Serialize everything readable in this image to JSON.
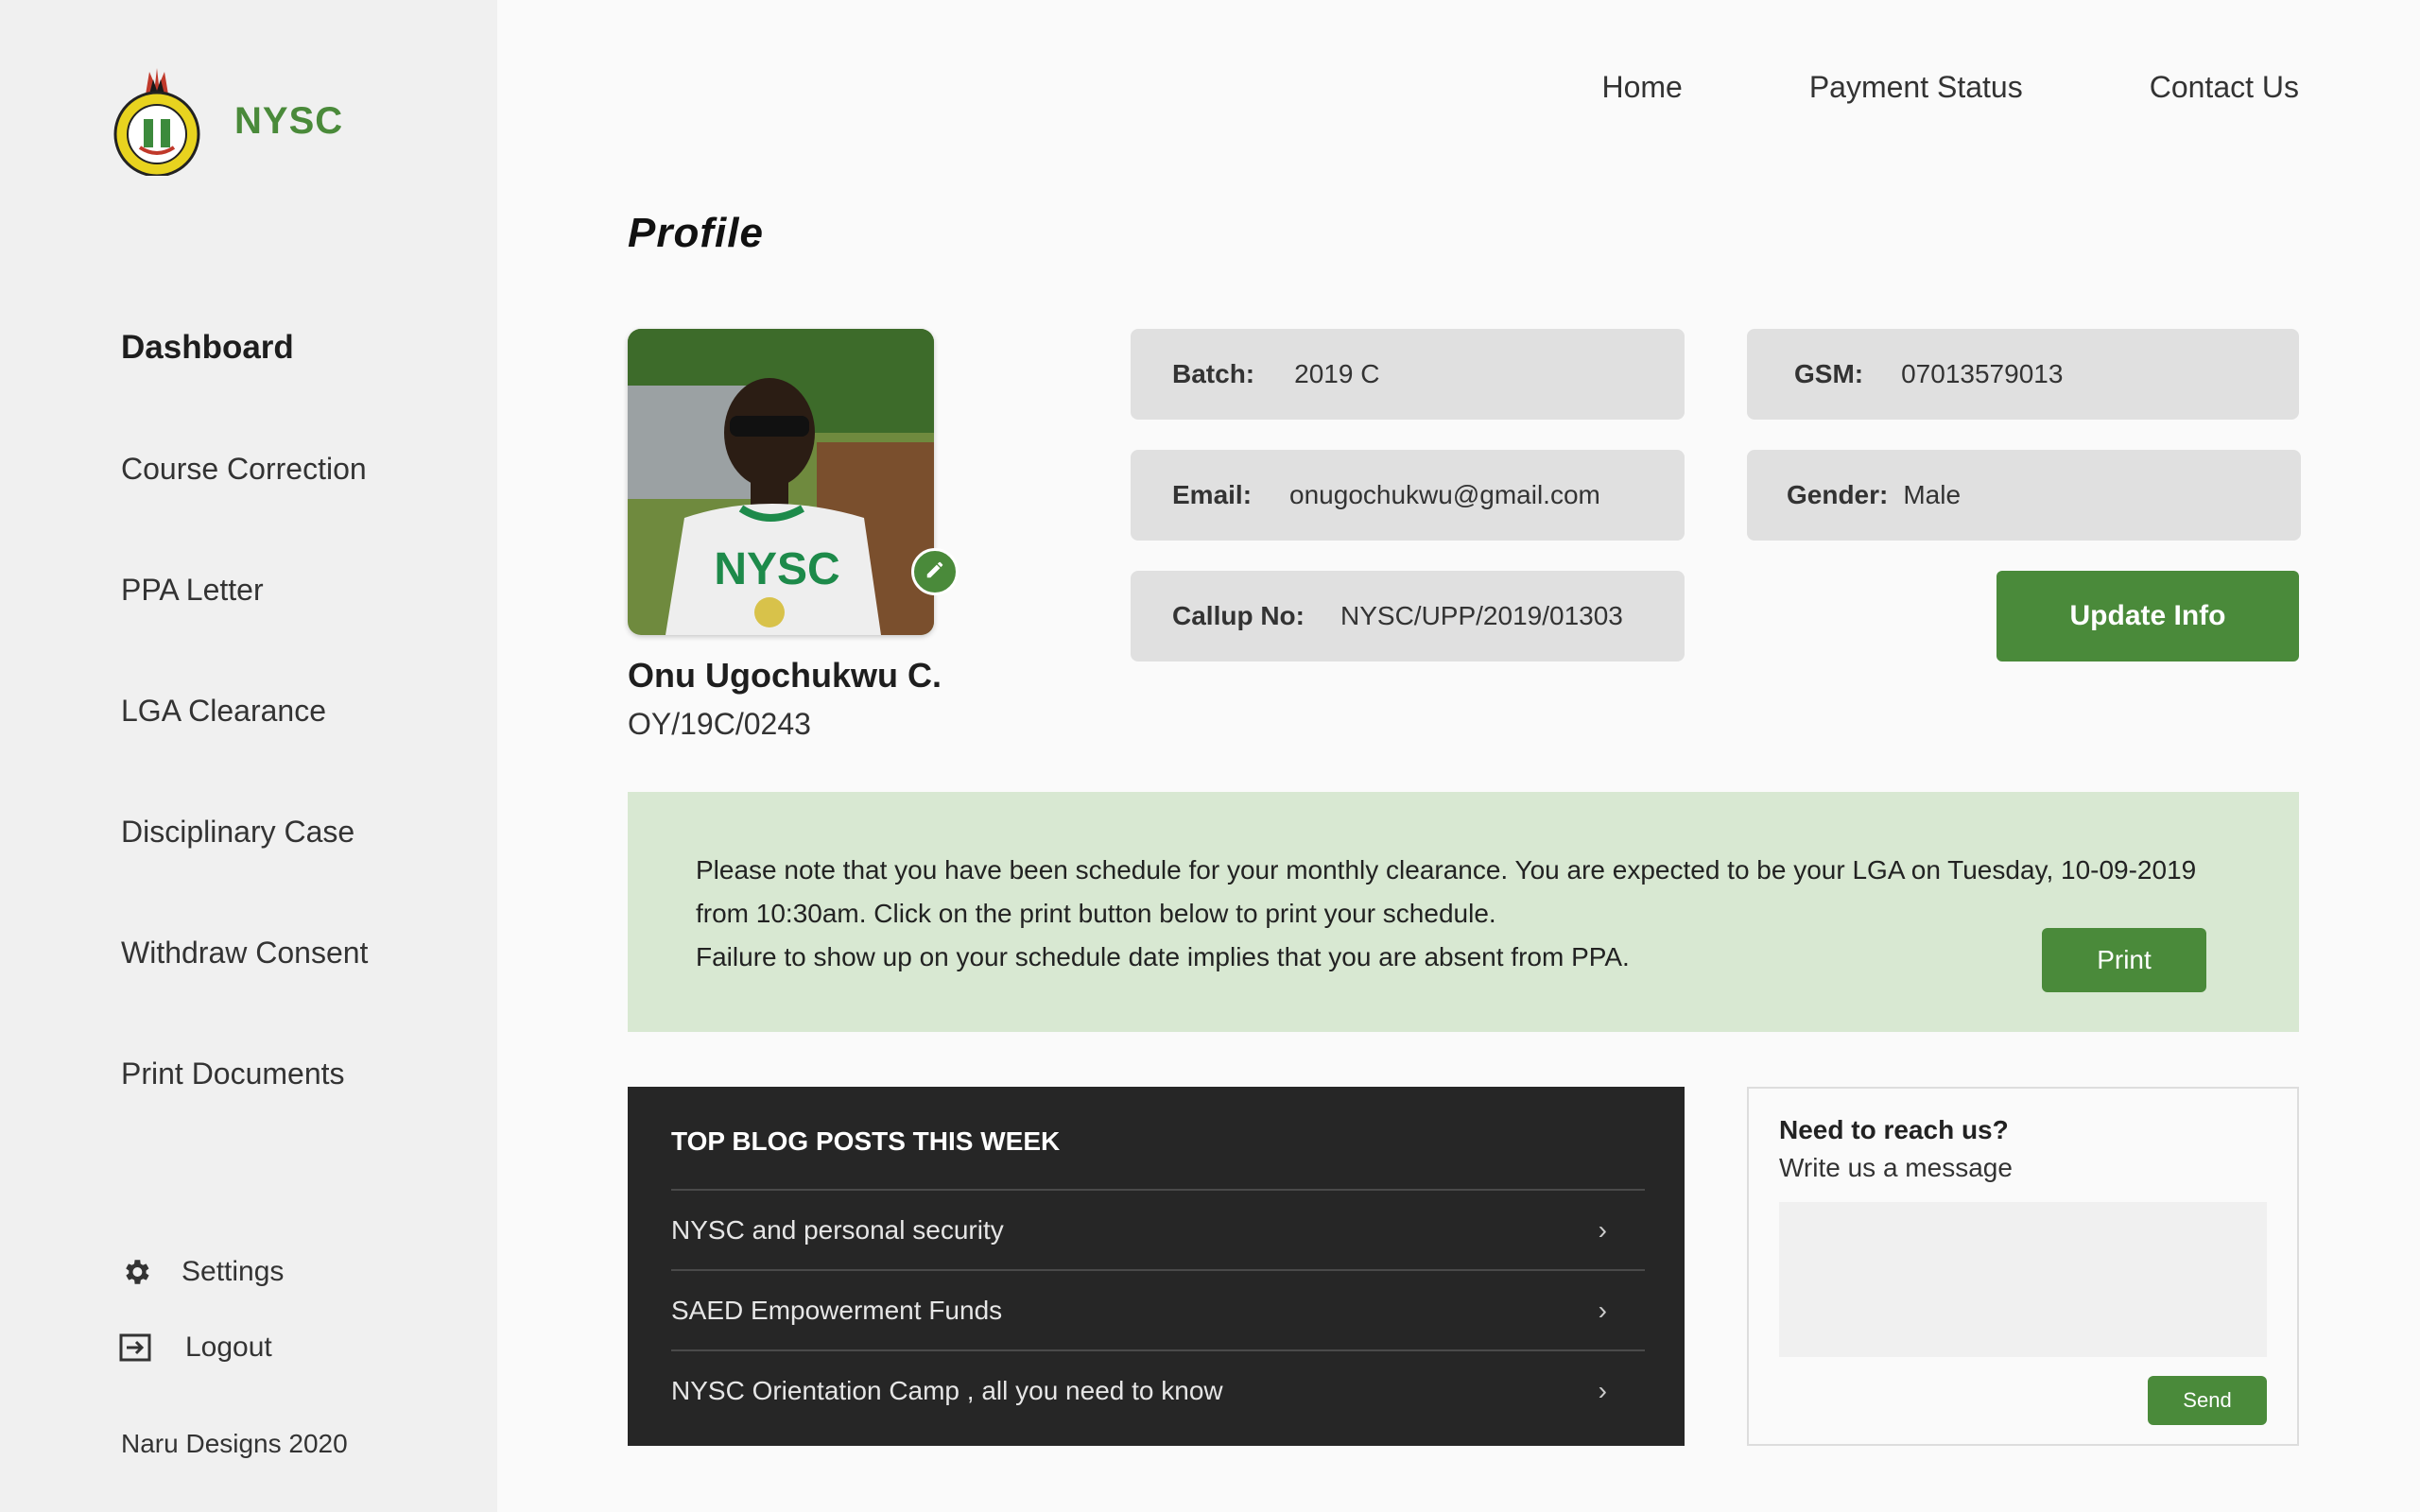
{
  "brand": {
    "name": "NYSC",
    "accent": "#4a8a3a"
  },
  "sidebar": {
    "items": [
      {
        "label": "Dashboard",
        "active": true
      },
      {
        "label": "Course Correction"
      },
      {
        "label": "PPA Letter"
      },
      {
        "label": "LGA Clearance"
      },
      {
        "label": "Disciplinary Case"
      },
      {
        "label": "Withdraw Consent"
      },
      {
        "label": "Print Documents"
      }
    ],
    "settings_label": "Settings",
    "logout_label": "Logout",
    "credit": "Naru Designs 2020"
  },
  "topnav": {
    "home": "Home",
    "payment_status": "Payment Status",
    "contact_us": "Contact Us"
  },
  "profile": {
    "title": "Profile",
    "name": "Onu Ugochukwu C.",
    "state_code": "OY/19C/0243",
    "fields": {
      "batch": {
        "label": "Batch:",
        "value": "2019 C"
      },
      "email": {
        "label": "Email:",
        "value": "onugochukwu@gmail.com"
      },
      "callup": {
        "label": "Callup No:",
        "value": "NYSC/UPP/2019/01303"
      },
      "gsm": {
        "label": "GSM:",
        "value": "07013579013"
      },
      "gender": {
        "label": "Gender:",
        "value": "Male"
      }
    },
    "update_label": "Update Info"
  },
  "notice": {
    "line1": "Please note that you have been schedule for your monthly clearance. You are expected to be your LGA on Tuesday, 10-09-2019",
    "line2": "from 10:30am. Click on the print button below to print your schedule.",
    "line3": "Failure to show up on your schedule date implies that you are absent from PPA.",
    "print_label": "Print"
  },
  "blog": {
    "title": "TOP BLOG POSTS THIS WEEK",
    "posts": [
      {
        "title": "NYSC and personal security"
      },
      {
        "title": "SAED Empowerment Funds"
      },
      {
        "title": "NYSC Orientation Camp , all you need to know"
      }
    ]
  },
  "contact": {
    "title": "Need to reach us?",
    "subtitle": "Write us a message",
    "message_value": "",
    "send_label": "Send"
  },
  "icons": {
    "settings": "gear-icon",
    "logout": "logout-icon",
    "edit": "pencil-icon",
    "chevron": "chevron-right-icon"
  }
}
